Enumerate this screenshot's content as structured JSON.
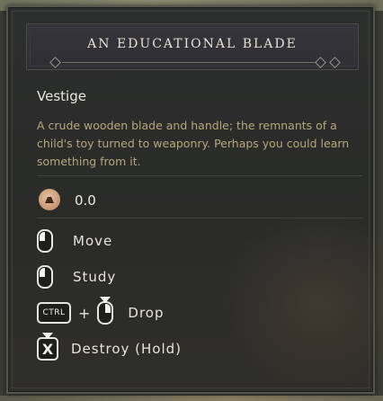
{
  "tooltip": {
    "title": "AN EDUCATIONAL BLADE",
    "item_type": "Vestige",
    "description": "A crude wooden blade and handle; the remnants of a child's toy turned to weaponry. Perhaps you could learn something from it.",
    "weight": {
      "icon": "weight-icon",
      "value": "0.0"
    },
    "actions": [
      {
        "input": "mouse-left-click",
        "label": "Move"
      },
      {
        "input": "mouse-right-click",
        "label": "Study"
      },
      {
        "input": "CTRL",
        "input2": "mouse-right-click",
        "label": "Drop"
      },
      {
        "input": "X",
        "label": "Destroy (Hold)"
      }
    ]
  },
  "colors": {
    "panel_bg": "#2a2b29",
    "description_text": "#b9a57b",
    "primary_text": "#e9e6dd",
    "weight_icon": "#d4a582"
  }
}
